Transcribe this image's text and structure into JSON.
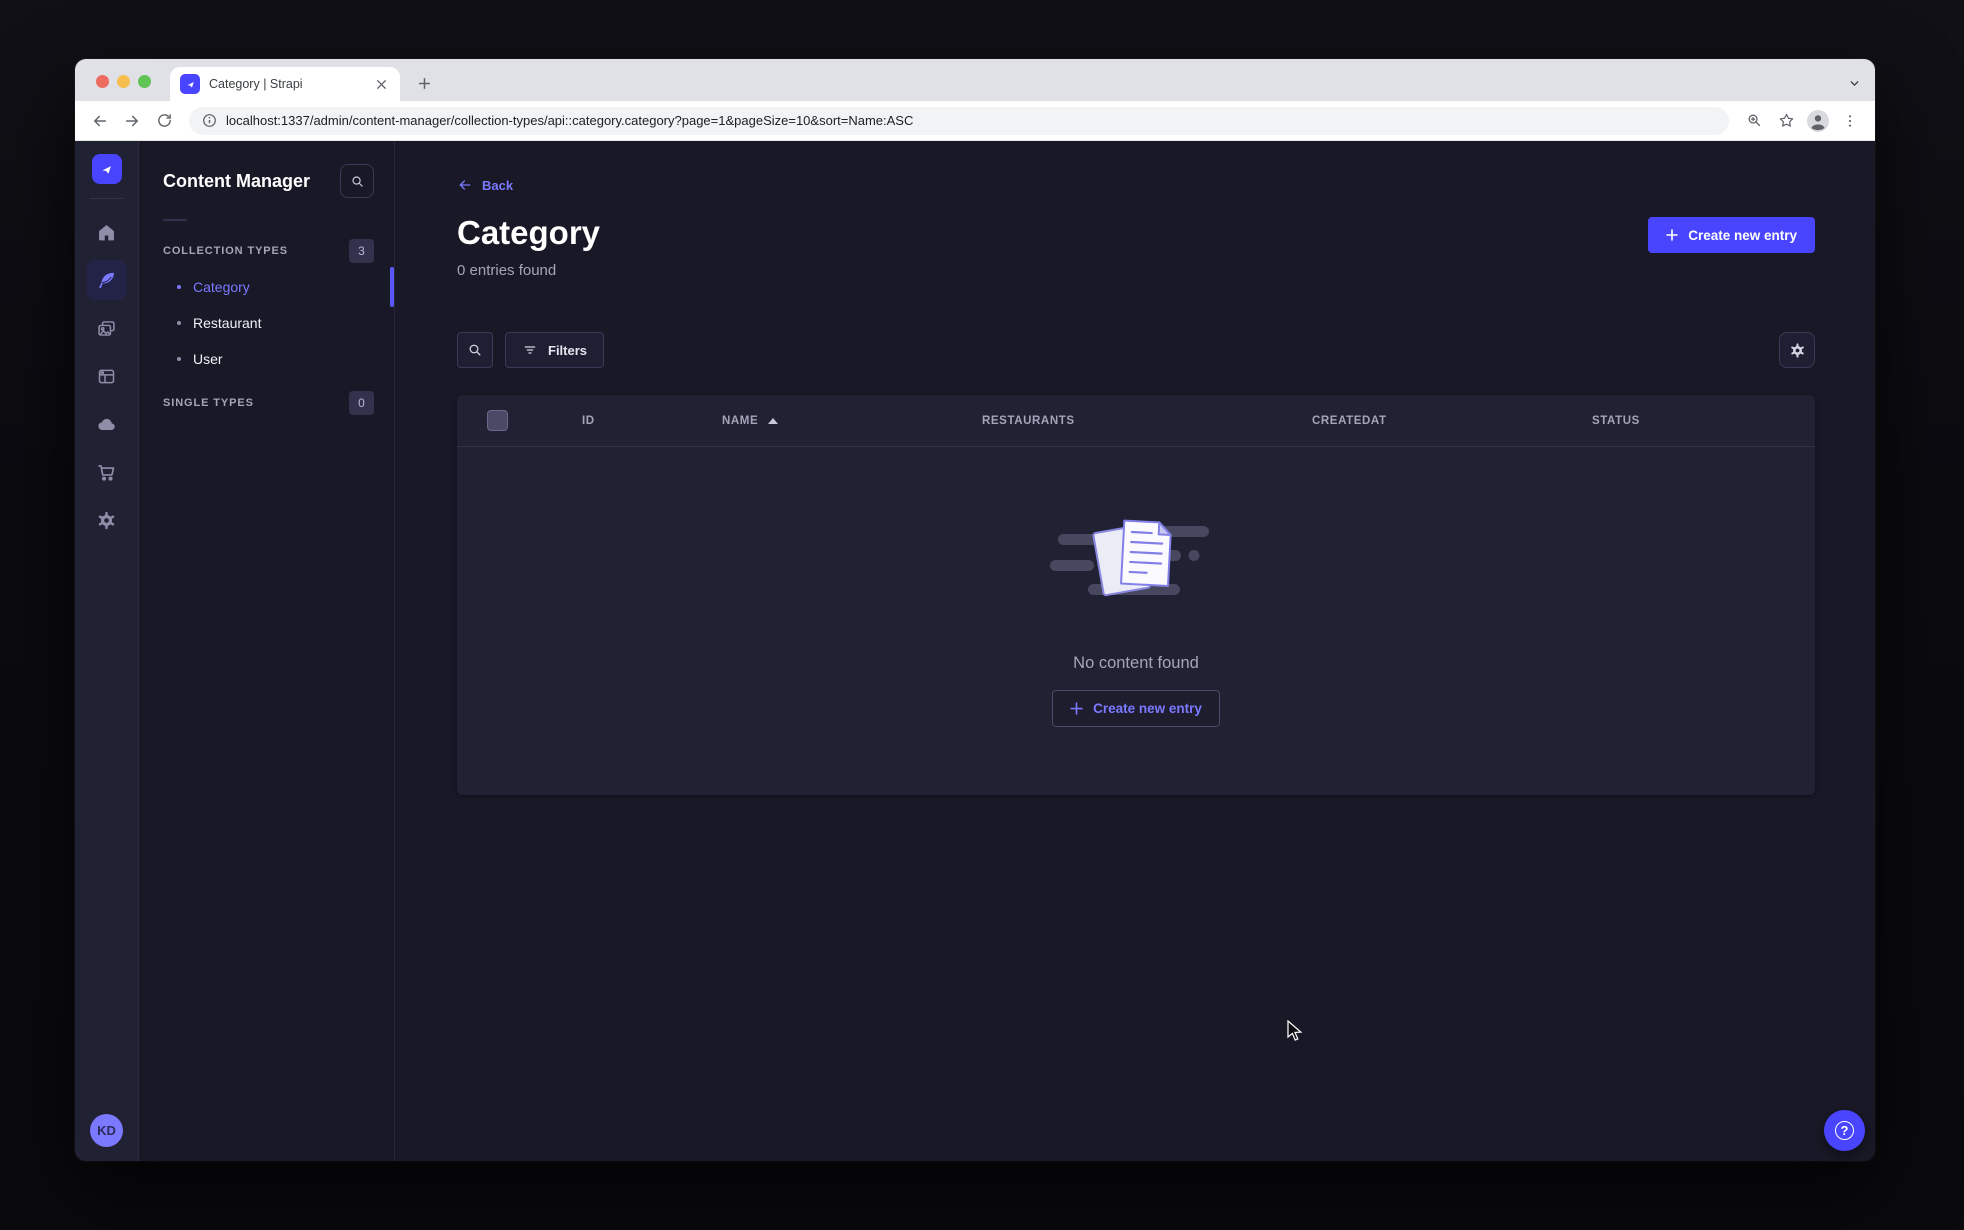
{
  "browser": {
    "tab_title": "Category | Strapi",
    "url": "localhost:1337/admin/content-manager/collection-types/api::category.category?page=1&pageSize=10&sort=Name:ASC"
  },
  "subnav": {
    "title": "Content Manager",
    "sections": [
      {
        "label": "COLLECTION TYPES",
        "count": "3",
        "items": [
          {
            "label": "Category",
            "active": true
          },
          {
            "label": "Restaurant",
            "active": false
          },
          {
            "label": "User",
            "active": false
          }
        ]
      },
      {
        "label": "SINGLE TYPES",
        "count": "0",
        "items": []
      }
    ]
  },
  "main": {
    "back_label": "Back",
    "title": "Category",
    "subtitle": "0 entries found",
    "create_button_label": "Create new entry",
    "filters_label": "Filters"
  },
  "table": {
    "columns": [
      "ID",
      "NAME",
      "RESTAURANTS",
      "CREATEDAT",
      "STATUS"
    ],
    "sorted_column": "NAME",
    "sort_direction": "asc"
  },
  "empty": {
    "message": "No content found",
    "create_button_label": "Create new entry"
  },
  "user": {
    "initials": "KD"
  },
  "icons": {
    "help_glyph": "?"
  },
  "colors": {
    "primary": "#4945ff",
    "link": "#7b79ff",
    "page_bg": "#181826",
    "card_bg": "#212134",
    "border": "#32324d",
    "text_secondary": "#a5a5ba"
  }
}
